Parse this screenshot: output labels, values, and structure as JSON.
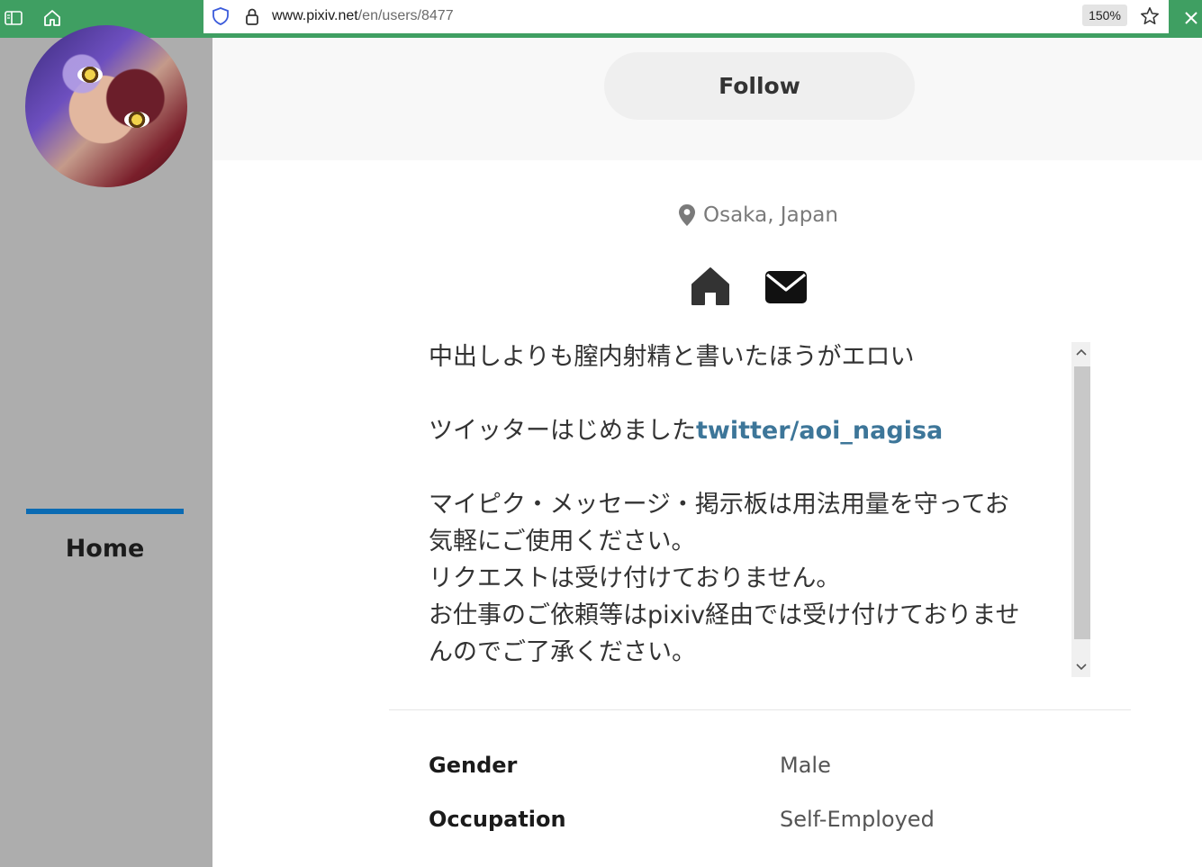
{
  "browser": {
    "url_host": "www.pixiv.net",
    "url_path": "/en/users/8477",
    "zoom": "150%"
  },
  "sidebar": {
    "nav_items": [
      {
        "label": "Home",
        "active": true
      }
    ]
  },
  "profile": {
    "follow_label": "Follow",
    "location": "Osaka, Japan",
    "links": [
      "home-icon",
      "mail-icon"
    ],
    "bio": {
      "line1": "中出しよりも膣内射精と書いたほうがエロい",
      "line2_prefix": "ツイッターはじめました",
      "line2_link": "twitter/aoi_nagisa",
      "line3": "マイピク・メッセージ・掲示板は用法用量を守ってお",
      "line4": "気軽にご使用ください。",
      "line5": "リクエストは受け付けておりません。",
      "line6": "お仕事のご依頼等はpixiv経由では受け付けておりませ",
      "line7": "んのでご了承ください。"
    },
    "details": [
      {
        "label": "Gender",
        "value": "Male"
      },
      {
        "label": "Occupation",
        "value": "Self-Employed"
      }
    ]
  },
  "colors": {
    "chrome": "#3f9f62",
    "sidebar": "#adadad",
    "nav_indicator": "#0b6bb3",
    "link": "#3d7699"
  }
}
